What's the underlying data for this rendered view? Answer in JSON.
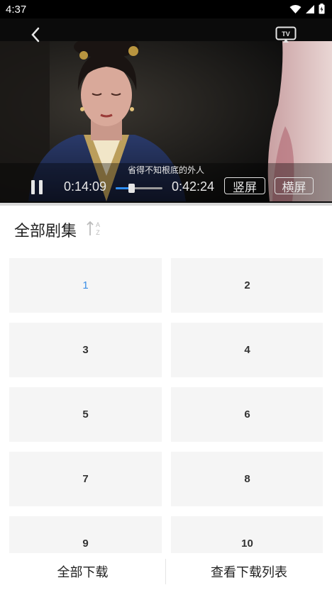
{
  "status_bar": {
    "time": "4:37",
    "icons": [
      "wifi-icon",
      "cellular-signal-icon",
      "battery-icon"
    ]
  },
  "player": {
    "subtitle": "省得不知根底的外人",
    "current_time": "0:14:09",
    "total_time": "0:42:24",
    "progress": 0.334,
    "portrait_label": "竖屏",
    "landscape_label": "横屏",
    "icons": {
      "back": "chevron-left-icon",
      "cast": "tv-cast-icon",
      "pause": "pause-icon"
    }
  },
  "episodes_panel": {
    "title": "全部剧集",
    "sort_icon": "sort-az-icon",
    "selected": "1",
    "episodes": [
      "1",
      "2",
      "3",
      "4",
      "5",
      "6",
      "7",
      "8",
      "9",
      "10"
    ]
  },
  "bottom_bar": {
    "download_all": "全部下载",
    "view_downloads": "查看下载列表"
  },
  "colors": {
    "accent": "#3a8ee6",
    "tile_bg": "#f5f5f5",
    "status_bar_bg": "#000000"
  }
}
